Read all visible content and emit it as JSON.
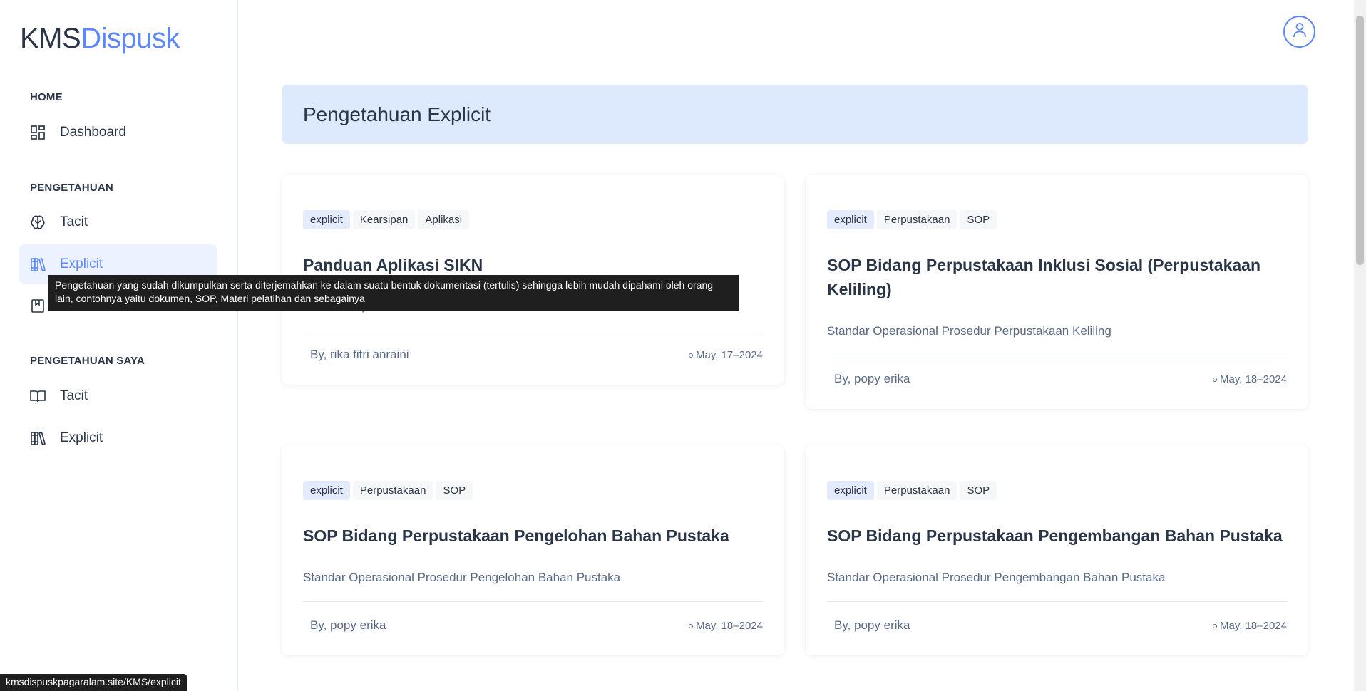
{
  "logo": {
    "part1": "KMS",
    "part2": "Dispusk"
  },
  "sidebar": {
    "sections": [
      {
        "caption": "HOME"
      },
      {
        "caption": "PENGETAHUAN"
      },
      {
        "caption": "PENGETAHUAN SAYA"
      }
    ],
    "items": [
      {
        "label": "Dashboard",
        "icon": "dashboard-icon"
      },
      {
        "label": "Tacit",
        "icon": "brain-icon"
      },
      {
        "label": "Explicit",
        "icon": "books-icon",
        "active": true
      },
      {
        "label": "Tacit",
        "icon": "book-open-icon"
      },
      {
        "label": "Explicit",
        "icon": "books-icon"
      }
    ]
  },
  "header": {
    "user_icon": "user-icon"
  },
  "page": {
    "title": "Pengetahuan Explicit"
  },
  "cards": [
    {
      "tags": [
        "explicit",
        "Kearsipan",
        "Aplikasi"
      ],
      "title": "Panduan Aplikasi SIKN",
      "description": "Panduan aplikasi SIKN",
      "author": "By, rika fitri anraini",
      "date": "May, 17–2024"
    },
    {
      "tags": [
        "explicit",
        "Perpustakaan",
        "SOP"
      ],
      "title": "SOP Bidang Perpustakaan Inklusi Sosial (Perpustakaan Keliling)",
      "description": "Standar Operasional Prosedur Perpustakaan Keliling",
      "author": "By, popy erika",
      "date": "May, 18–2024"
    },
    {
      "tags": [
        "explicit",
        "Perpustakaan",
        "SOP"
      ],
      "title": "SOP Bidang Perpustakaan Pengelohan Bahan Pustaka",
      "description": "Standar Operasional Prosedur Pengelohan Bahan Pustaka",
      "author": "By, popy erika",
      "date": "May, 18–2024"
    },
    {
      "tags": [
        "explicit",
        "Perpustakaan",
        "SOP"
      ],
      "title": "SOP Bidang Perpustakaan Pengembangan Bahan Pustaka",
      "description": "Standar Operasional Prosedur Pengembangan Bahan Pustaka",
      "author": "By, popy erika",
      "date": "May, 18–2024"
    }
  ],
  "tooltip": {
    "text": "Pengetahuan yang sudah dikumpulkan serta diterjemahkan ke dalam suatu bentuk dokumentasi (tertulis) sehingga lebih mudah dipahami oleh orang lain, contohnya yaitu dokumen, SOP, Materi pelatihan dan sebagainya"
  },
  "statusbar": {
    "url": "kmsdispuskpagaralam.site/KMS/explicit"
  },
  "colors": {
    "accent": "#5d87ff",
    "banner": "#dde9fd",
    "active_bg": "#ecf2ff",
    "text": "#2a3547"
  }
}
